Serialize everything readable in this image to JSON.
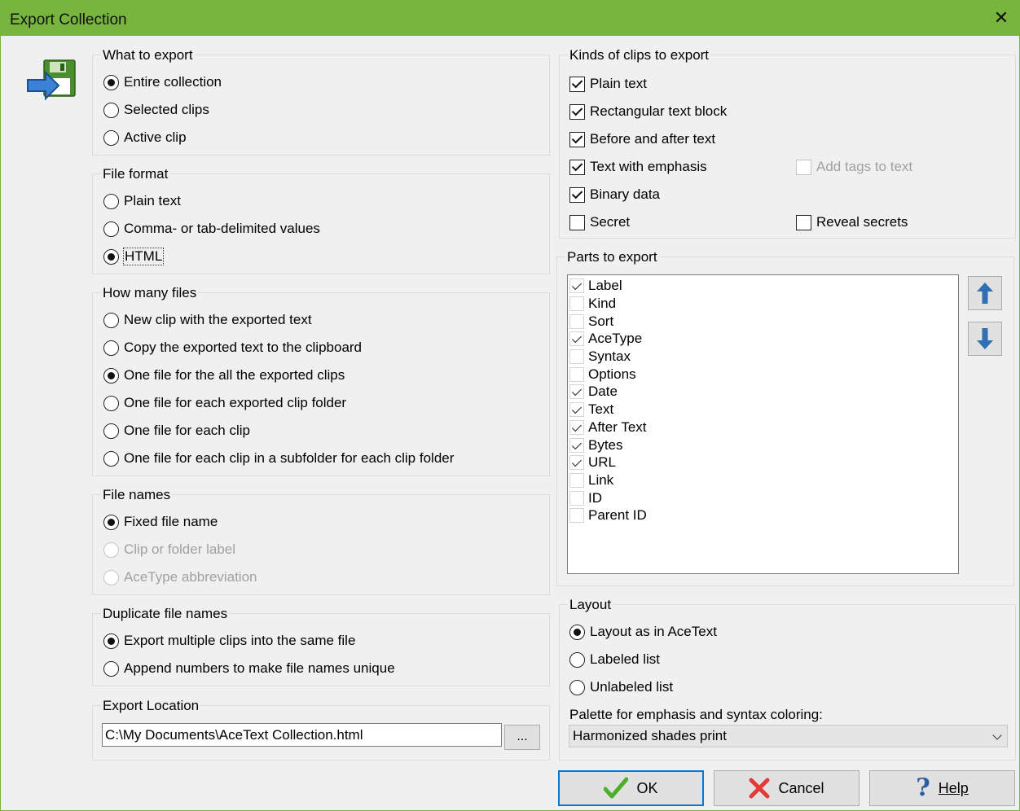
{
  "window": {
    "title": "Export Collection",
    "close_glyph": "✕"
  },
  "what_to_export": {
    "legend": "What to export",
    "options": [
      {
        "label": "Entire collection",
        "selected": true
      },
      {
        "label": "Selected clips",
        "selected": false
      },
      {
        "label": "Active clip",
        "selected": false
      }
    ]
  },
  "file_format": {
    "legend": "File format",
    "options": [
      {
        "label": "Plain text",
        "selected": false
      },
      {
        "label": "Comma- or tab-delimited values",
        "selected": false
      },
      {
        "label": "HTML",
        "selected": true
      }
    ]
  },
  "how_many_files": {
    "legend": "How many files",
    "options": [
      {
        "label": "New clip with the exported text",
        "selected": false
      },
      {
        "label": "Copy the exported text to the clipboard",
        "selected": false
      },
      {
        "label": "One file for the all the exported clips",
        "selected": true
      },
      {
        "label": "One file for each exported clip folder",
        "selected": false
      },
      {
        "label": "One file for each clip",
        "selected": false
      },
      {
        "label": "One file for each clip in a subfolder for each clip folder",
        "selected": false
      }
    ]
  },
  "file_names": {
    "legend": "File names",
    "options": [
      {
        "label": "Fixed file name",
        "selected": true,
        "enabled": true
      },
      {
        "label": "Clip or folder label",
        "selected": false,
        "enabled": false
      },
      {
        "label": "AceType abbreviation",
        "selected": false,
        "enabled": false
      }
    ]
  },
  "duplicate_file_names": {
    "legend": "Duplicate file names",
    "options": [
      {
        "label": "Export multiple clips into the same file",
        "selected": true
      },
      {
        "label": "Append numbers to make file names unique",
        "selected": false
      }
    ]
  },
  "export_location": {
    "legend": "Export Location",
    "value": "C:\\My Documents\\AceText Collection.html",
    "browse_label": "..."
  },
  "kinds": {
    "legend": "Kinds of clips to export",
    "plain_text": {
      "label": "Plain text",
      "checked": true
    },
    "rectangular": {
      "label": "Rectangular text block",
      "checked": true
    },
    "before_after": {
      "label": "Before and after text",
      "checked": true
    },
    "emphasis": {
      "label": "Text with emphasis",
      "checked": true
    },
    "add_tags": {
      "label": "Add tags to text",
      "checked": false,
      "enabled": false
    },
    "binary": {
      "label": "Binary data",
      "checked": true
    },
    "secret": {
      "label": "Secret",
      "checked": false
    },
    "reveal": {
      "label": "Reveal secrets",
      "checked": false
    }
  },
  "parts": {
    "legend": "Parts to export",
    "items": [
      {
        "label": "Label",
        "checked": true
      },
      {
        "label": "Kind",
        "checked": false
      },
      {
        "label": "Sort",
        "checked": false
      },
      {
        "label": "AceType",
        "checked": true
      },
      {
        "label": "Syntax",
        "checked": false
      },
      {
        "label": "Options",
        "checked": false
      },
      {
        "label": "Date",
        "checked": true
      },
      {
        "label": "Text",
        "checked": true
      },
      {
        "label": "After Text",
        "checked": true
      },
      {
        "label": "Bytes",
        "checked": true
      },
      {
        "label": "URL",
        "checked": true
      },
      {
        "label": "Link",
        "checked": false
      },
      {
        "label": "ID",
        "checked": false
      },
      {
        "label": "Parent ID",
        "checked": false
      }
    ]
  },
  "layout": {
    "legend": "Layout",
    "options": [
      {
        "label": "Layout as in AceText",
        "selected": true
      },
      {
        "label": "Labeled list",
        "selected": false
      },
      {
        "label": "Unlabeled list",
        "selected": false
      }
    ],
    "palette_label": "Palette for emphasis and syntax coloring:",
    "palette_value": "Harmonized shades print"
  },
  "buttons": {
    "ok": "OK",
    "cancel": "Cancel",
    "help": "Help"
  },
  "colors": {
    "titlebar": "#77b53f",
    "accent": "#0078d7",
    "ok_check": "#4caf2a",
    "cancel_x": "#e53935",
    "arrow": "#2f6fb3"
  }
}
